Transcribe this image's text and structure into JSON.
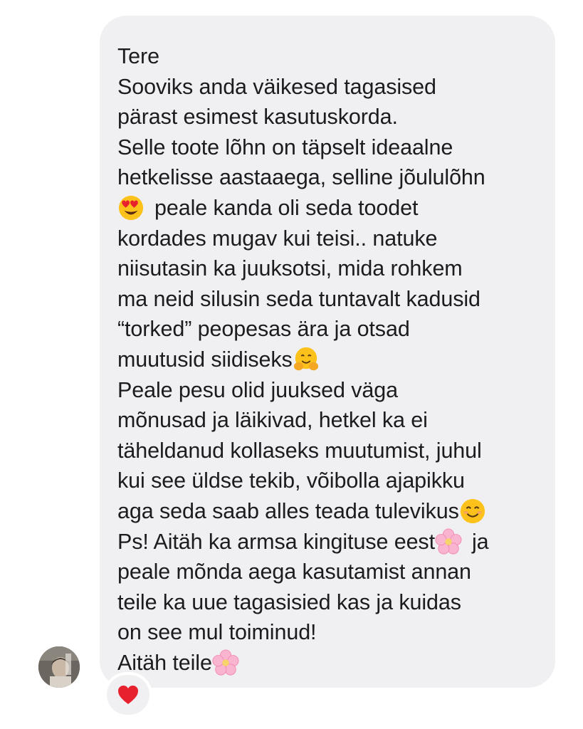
{
  "message": {
    "lines": {
      "l1": "Tere",
      "l2": "Sooviks anda väikesed tagasised",
      "l3": "pärast esimest kasutuskorda.",
      "l4": "Selle toote lõhn on täpselt ideaalne",
      "l5": "hetkelisse aastaaega, selline jõululõhn",
      "l6": "peale kanda oli seda toodet",
      "l7": "kordades mugav kui teisi.. natuke",
      "l8": "niisutasin ka juuksotsi, mida rohkem",
      "l9": "ma neid silusin seda tuntavalt kadusid",
      "l10": "“torked” peopesas ära ja otsad",
      "l11": "muutusid siidiseks",
      "l12": "Peale pesu olid juuksed väga",
      "l13": "mõnusad ja läikivad, hetkel ka ei",
      "l14": "täheldanud kollaseks muutumist, juhul",
      "l15": "kui see üldse tekib, võibolla ajapikku",
      "l16": "aga seda saab alles teada tulevikus",
      "l17a": "Ps! Aitäh ka armsa kingituse eest",
      "l17b": "ja",
      "l18": "peale mõnda aega kasutamist annan",
      "l19": "teile ka uue tagasisied kas ja kuidas",
      "l20": "on see mul toiminud!",
      "l21": "Aitäh teile"
    },
    "emojis": {
      "heart_eyes": "smiling-face-with-heart-eyes-icon",
      "hugging": "hugging-face-icon",
      "smiling": "smiling-face-icon",
      "blossom": "cherry-blossom-icon"
    }
  },
  "reaction": {
    "icon": "red-heart-icon",
    "color": "#e8212e"
  },
  "colors": {
    "bubble": "#f0f0f3",
    "text": "#1c1c1e"
  }
}
